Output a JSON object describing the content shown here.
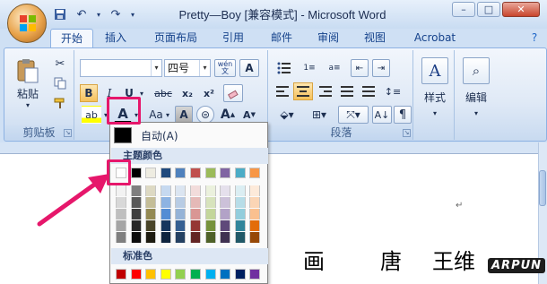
{
  "window": {
    "title": "Pretty—Boy [兼容模式] - Microsoft Word",
    "controls": [
      "–",
      "□",
      "✕"
    ]
  },
  "quick_access": [
    "save",
    "undo",
    "redo",
    "customize"
  ],
  "tabs": [
    {
      "label": "开始",
      "active": true
    },
    {
      "label": "插入"
    },
    {
      "label": "页面布局"
    },
    {
      "label": "引用"
    },
    {
      "label": "邮件"
    },
    {
      "label": "审阅"
    },
    {
      "label": "视图"
    },
    {
      "label": "Acrobat"
    }
  ],
  "ribbon": {
    "clipboard": {
      "paste_label": "粘贴",
      "group_label": "剪贴板"
    },
    "font": {
      "font_name": "",
      "font_size": "四号",
      "wen": "wén\n文",
      "bold": "B",
      "italic": "I",
      "underline": "U",
      "strike": "abc",
      "subscript": "x₂",
      "superscript": "x²",
      "font_color": "A",
      "change_case": "Aa",
      "grow": "A",
      "shrink": "A"
    },
    "paragraph": {
      "group_label": "段落"
    },
    "styles": {
      "label": "样式"
    },
    "editing": {
      "label": "编辑"
    }
  },
  "color_menu": {
    "auto_label": "自动(A)",
    "theme_header": "主题颜色",
    "standard_header": "标准色",
    "theme_top": [
      "#ffffff",
      "#000000",
      "#eeece1",
      "#1f497d",
      "#4f81bd",
      "#c0504d",
      "#9bbb59",
      "#8064a2",
      "#4bacc6",
      "#f79646"
    ],
    "theme_tints": [
      [
        "#f2f2f2",
        "#7f7f7f",
        "#ddd9c3",
        "#c6d9f0",
        "#dbe5f1",
        "#f2dcdb",
        "#ebf1dd",
        "#e5e0ec",
        "#dbeef3",
        "#fdeada"
      ],
      [
        "#d8d8d8",
        "#595959",
        "#c4bd97",
        "#8db3e2",
        "#b8cce4",
        "#e5b9b7",
        "#d7e3bc",
        "#ccc1d9",
        "#b7dde8",
        "#fbd5b5"
      ],
      [
        "#bfbfbf",
        "#3f3f3f",
        "#938953",
        "#548dd4",
        "#95b3d7",
        "#d99694",
        "#c3d69b",
        "#b2a2c7",
        "#92cddc",
        "#fac08f"
      ],
      [
        "#a5a5a5",
        "#262626",
        "#494429",
        "#17365d",
        "#366092",
        "#953734",
        "#76923c",
        "#5f497a",
        "#31859b",
        "#e36c09"
      ],
      [
        "#7f7f7f",
        "#0c0c0c",
        "#1d1b10",
        "#0f243e",
        "#244061",
        "#632423",
        "#4f6128",
        "#3f3151",
        "#205867",
        "#974806"
      ]
    ],
    "standard": [
      "#c00000",
      "#ff0000",
      "#ffc000",
      "#ffff00",
      "#92d050",
      "#00b050",
      "#00b0f0",
      "#0070c0",
      "#002060",
      "#7030a0"
    ]
  },
  "document": {
    "text": [
      "画",
      "唐",
      "王维"
    ],
    "paragraph_mark": "↵"
  },
  "watermark": "ARPUN"
}
